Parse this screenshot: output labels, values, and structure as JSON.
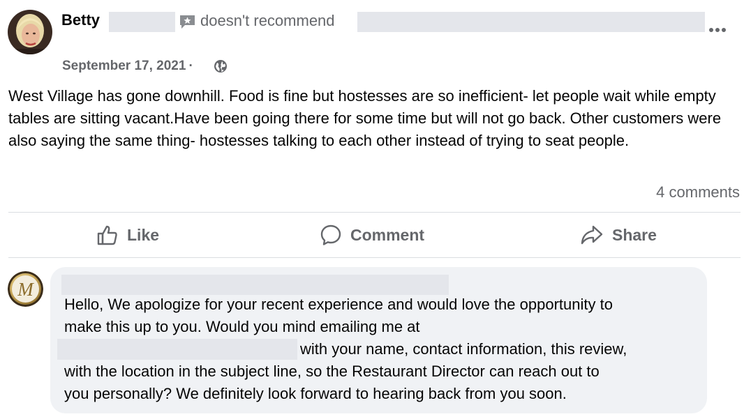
{
  "review": {
    "author_name": "Betty",
    "recommendation": "doesn't recommend",
    "date": "September 17, 2021",
    "separator": "·",
    "text": "West Village has gone downhill. Food is fine but hostesses are so inefficient- let people wait while empty tables are sitting vacant.Have been going there for some time but will not go back. Other customers were also saying the same thing- hostesses talking to each other instead of trying to seat people.",
    "comments_count": "4 comments"
  },
  "actions": {
    "like_label": "Like",
    "comment_label": "Comment",
    "share_label": "Share"
  },
  "reply": {
    "avatar_letter": "M",
    "line1": "Hello, We apologize for your recent experience and would love the opportunity to",
    "line2": "make this up to you. Would you mind emailing me at",
    "line3": "with your name, contact information, this review,",
    "line4": "with the location in the subject line, so the Restaurant Director can reach out to",
    "line5": "you personally? We definitely look forward to hearing back from you soon."
  },
  "icons": {
    "more": "more-options-icon",
    "globe": "globe-icon",
    "recommend": "recommend-icon",
    "like": "thumbs-up-icon",
    "comment": "comment-bubble-icon",
    "share": "share-arrow-icon"
  },
  "colors": {
    "secondary_text": "#65676b",
    "primary_text": "#050505",
    "bubble_background": "#f0f2f5",
    "redaction": "#e4e6eb"
  }
}
